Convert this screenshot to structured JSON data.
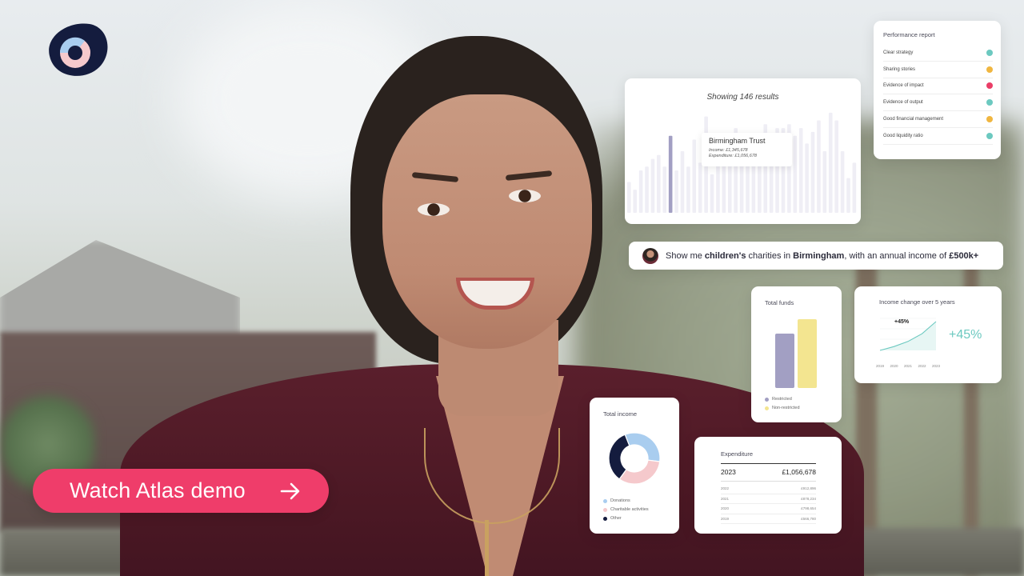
{
  "colors": {
    "accent": "#ef3d6a",
    "teal": "#6cc9c0",
    "amber": "#f0b640",
    "red": "#ea3e67",
    "lavender": "#a29fc3",
    "yellow": "#f3e590",
    "navy": "#141c3e",
    "blue": "#a9cdef",
    "pink": "#f5c9cc"
  },
  "cta": {
    "label": "Watch Atlas demo",
    "icon": "arrow-right-icon"
  },
  "results_card": {
    "heading": "Showing 146 results",
    "tooltip": {
      "title": "Birmingham Trust",
      "income": "Income: £1,345,678",
      "expenditure": "Expenditure: £1,056,678"
    }
  },
  "performance_report": {
    "title": "Performance report",
    "items": [
      {
        "label": "Clear strategy",
        "status_color": "#6cc9c0"
      },
      {
        "label": "Sharing stories",
        "status_color": "#f0b640"
      },
      {
        "label": "Evidence of impact",
        "status_color": "#ea3e67"
      },
      {
        "label": "Evidence of output",
        "status_color": "#6cc9c0"
      },
      {
        "label": "Good financial management",
        "status_color": "#f0b640"
      },
      {
        "label": "Good liquidity ratio",
        "status_color": "#6cc9c0"
      }
    ]
  },
  "query": {
    "prefix": "Show me ",
    "bold1": "children's",
    "mid1": " charities in ",
    "bold2": "Birmingham",
    "mid2": ", with an annual income of ",
    "bold3": "£500k+"
  },
  "total_funds": {
    "title": "Total funds",
    "legend": [
      "Restricted",
      "Non-restricted"
    ]
  },
  "income_change": {
    "title": "Income change over 5 years",
    "badge": "+45%",
    "big_value": "+45%",
    "years": [
      "2019",
      "2020",
      "2021",
      "2022",
      "2023"
    ]
  },
  "total_income": {
    "title": "Total income",
    "legend": [
      "Donations",
      "Charitable activities",
      "Other"
    ]
  },
  "expenditure": {
    "title": "Expenditure",
    "year": "2023",
    "value": "£1,056,678",
    "rows": [
      {
        "year": "2022",
        "value": "£912,896"
      },
      {
        "year": "2021",
        "value": "£878,234"
      },
      {
        "year": "2020",
        "value": "£798,654"
      },
      {
        "year": "2019",
        "value": "£566,780"
      }
    ]
  },
  "chart_data": [
    {
      "type": "bar",
      "chart": "results",
      "highlight_index": 7,
      "values": [
        40,
        30,
        55,
        60,
        70,
        75,
        60,
        100,
        55,
        80,
        60,
        95,
        65,
        125,
        50,
        80,
        100,
        75,
        110,
        90,
        95,
        70,
        85,
        115,
        70,
        110,
        110,
        115,
        100,
        110,
        90,
        105,
        120,
        80,
        130,
        120,
        80,
        45,
        65
      ]
    },
    {
      "type": "bar",
      "chart": "total_funds",
      "categories": [
        "Restricted",
        "Non-restricted"
      ],
      "values": [
        68,
        86
      ]
    },
    {
      "type": "line",
      "chart": "income_change",
      "x": [
        "2019",
        "2020",
        "2021",
        "2022",
        "2023"
      ],
      "values": [
        0,
        6,
        14,
        26,
        45
      ]
    },
    {
      "type": "pie",
      "chart": "total_income",
      "categories": [
        "Donations",
        "Charitable activities",
        "Other"
      ],
      "values": [
        33,
        33,
        34
      ]
    }
  ]
}
